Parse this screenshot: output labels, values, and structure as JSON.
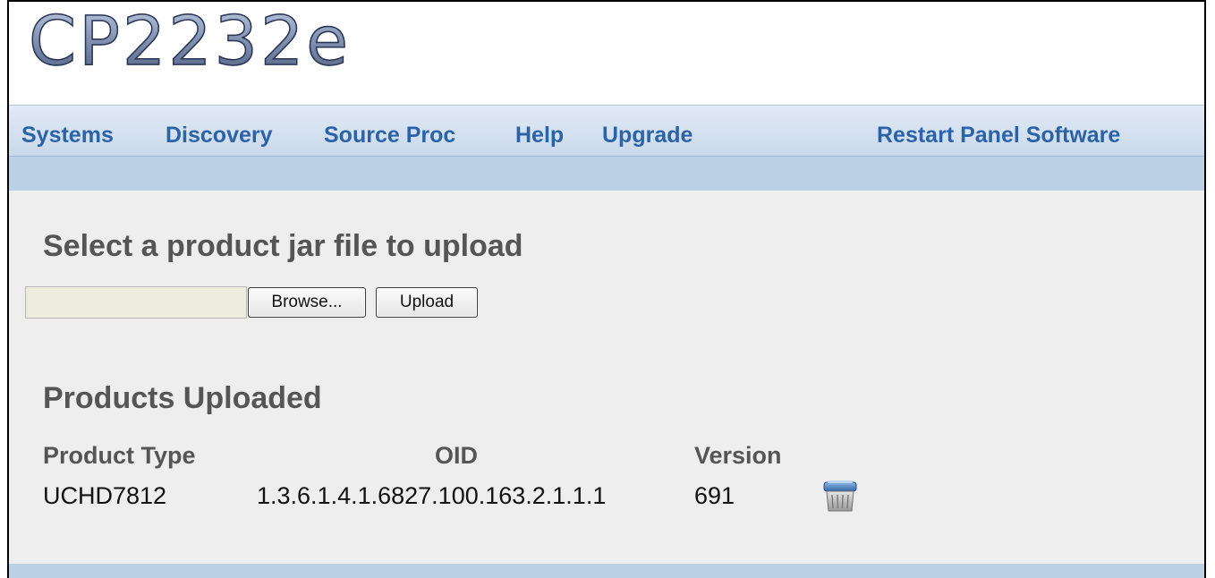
{
  "app": {
    "logo_text": "CP2232e"
  },
  "nav": {
    "items": [
      {
        "label": "Systems"
      },
      {
        "label": "Discovery"
      },
      {
        "label": "Source Proc"
      },
      {
        "label": "Help"
      },
      {
        "label": "Upgrade"
      }
    ],
    "restart_label": "Restart Panel Software"
  },
  "upload": {
    "heading": "Select a product jar file to upload",
    "file_value": "",
    "browse_label": "Browse...",
    "upload_label": "Upload"
  },
  "products": {
    "heading": "Products Uploaded",
    "columns": [
      "Product Type",
      "OID",
      "Version"
    ],
    "rows": [
      {
        "product_type": "UCHD7812",
        "oid": "1.3.6.1.4.1.6827.100.163.2.1.1.1",
        "version": "691",
        "action_icon": "delete-icon"
      }
    ]
  },
  "colors": {
    "nav_link": "#2b63a8",
    "nav_bg": "#c9d8ea",
    "subbar_bg": "#bcd0e6",
    "content_bg": "#eeeeee",
    "heading_text": "#555555"
  }
}
